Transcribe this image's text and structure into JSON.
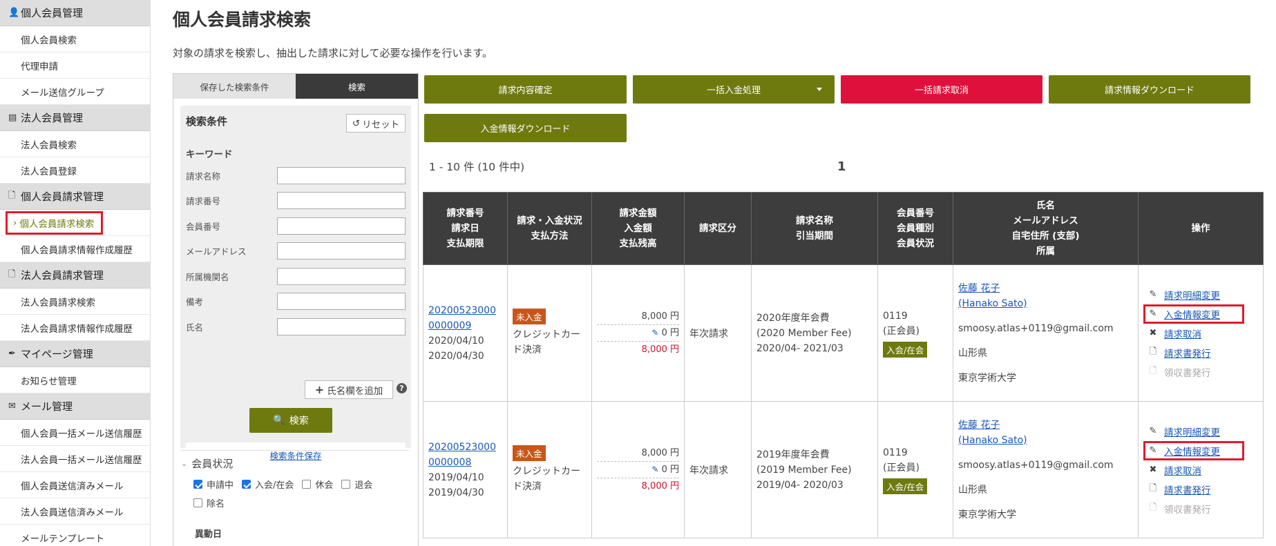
{
  "sidebar": {
    "sections": [
      {
        "title": "個人会員管理",
        "icon": "person-icon",
        "items": [
          "個人会員検索",
          "代理申請",
          "メール送信グループ"
        ]
      },
      {
        "title": "法人会員管理",
        "icon": "building-icon",
        "items": [
          "法人会員検索",
          "法人会員登録"
        ]
      },
      {
        "title": "個人会員請求管理",
        "icon": "document-icon",
        "items": [
          "個人会員請求検索",
          "個人会員請求情報作成履歴"
        ]
      },
      {
        "title": "法人会員請求管理",
        "icon": "document-icon",
        "items": [
          "法人会員請求検索",
          "法人会員請求情報作成履歴"
        ]
      },
      {
        "title": "マイページ管理",
        "icon": "pen-icon",
        "items": [
          "お知らせ管理"
        ]
      },
      {
        "title": "メール管理",
        "icon": "mail-icon",
        "items": [
          "個人会員一括メール送信履歴",
          "法人会員一括メール送信履歴",
          "個人会員送信済みメール",
          "法人会員送信済みメール",
          "メールテンプレート"
        ]
      }
    ],
    "active_item": "個人会員請求検索"
  },
  "page": {
    "title": "個人会員請求検索",
    "description": "対象の請求を検索し、抽出した請求に対して必要な操作を行います。"
  },
  "search": {
    "tab_saved": "保存した検索条件",
    "tab_search": "検索",
    "title": "検索条件",
    "reset": "リセット",
    "keyword_label": "キーワード",
    "fields": [
      "請求名称",
      "請求番号",
      "会員番号",
      "メールアドレス",
      "所属機関名",
      "備考",
      "氏名"
    ],
    "add_name": "氏名欄を追加",
    "help": "?",
    "search_button": "検索",
    "save_condition": "検索条件保存",
    "status_title": "会員状況",
    "statuses": [
      {
        "label": "申請中",
        "checked": true
      },
      {
        "label": "入会/在会",
        "checked": true
      },
      {
        "label": "休会",
        "checked": false
      },
      {
        "label": "退会",
        "checked": false
      },
      {
        "label": "除名",
        "checked": false
      }
    ],
    "move_date": "異動日"
  },
  "actions": {
    "confirm": "請求内容確定",
    "bulk_payment": "一括入金処理",
    "bulk_cancel": "一括請求取消",
    "download_billing": "請求情報ダウンロード",
    "download_payment": "入金情報ダウンロード"
  },
  "results": {
    "count_text": "1 - 10 件 (10 件中)",
    "page": "1",
    "headers": [
      [
        "請求番号",
        "請求日",
        "支払期限"
      ],
      [
        "請求・入金状況",
        "支払方法"
      ],
      [
        "請求金額",
        "入金額",
        "支払残高"
      ],
      [
        "請求区分"
      ],
      [
        "請求名称",
        "引当期間"
      ],
      [
        "会員番号",
        "会員種別",
        "会員状況"
      ],
      [
        "氏名",
        "メールアドレス",
        "自宅住所 (支部)",
        "所属"
      ],
      [
        "操作"
      ]
    ],
    "rows": [
      {
        "invoice_no_1": "20200523000",
        "invoice_no_2": "0000009",
        "invoice_date": "2020/04/10",
        "due_date": "2020/04/30",
        "status_badge": "未入金",
        "pay_method_1": "クレジットカー",
        "pay_method_2": "ド決済",
        "billed": "8,000 円",
        "paid": "0 円",
        "balance": "8,000 円",
        "category": "年次請求",
        "name_1": "2020年度年会費",
        "name_2": "(2020 Member Fee)",
        "period": "2020/04- 2021/03",
        "member_no": "0119",
        "member_type": "(正会員)",
        "member_status": "入会/在会",
        "person_name": "佐藤 花子",
        "person_name_en": "(Hanako Sato)",
        "email": "smoosy.atlas+0119@gmail.com",
        "address": "山形県",
        "org": "東京学術大学"
      },
      {
        "invoice_no_1": "20200523000",
        "invoice_no_2": "0000008",
        "invoice_date": "2019/04/10",
        "due_date": "2019/04/30",
        "status_badge": "未入金",
        "pay_method_1": "クレジットカー",
        "pay_method_2": "ド決済",
        "billed": "8,000 円",
        "paid": "0 円",
        "balance": "8,000 円",
        "category": "年次請求",
        "name_1": "2019年度年会費",
        "name_2": "(2019 Member Fee)",
        "period": "2019/04- 2020/03",
        "member_no": "0119",
        "member_type": "(正会員)",
        "member_status": "入会/在会",
        "person_name": "佐藤 花子",
        "person_name_en": "(Hanako Sato)",
        "email": "smoosy.atlas+0119@gmail.com",
        "address": "山形県",
        "org": "東京学術大学"
      }
    ],
    "operations": [
      "請求明細変更",
      "入金情報変更",
      "請求取消",
      "請求書発行",
      "領収書発行"
    ]
  },
  "colors": {
    "olive": "#6e7a0e",
    "red": "#e0103c",
    "link": "#1a56b8",
    "highlight": "#e01a2c"
  }
}
